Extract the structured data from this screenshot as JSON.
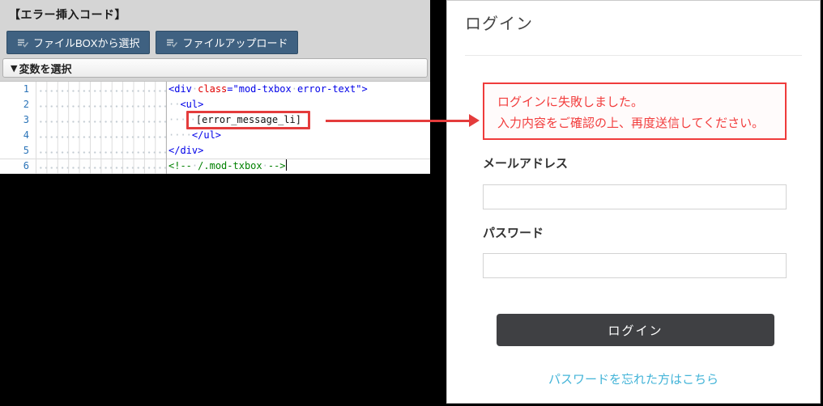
{
  "colors": {
    "annotation_red": "#e43c3c",
    "error_text_red": "#f23d3d",
    "error_border_red": "#ef3b3b",
    "toolbar_button_blue": "#3f6181",
    "login_button_dark": "#3f4043",
    "link_blue": "#43b4d8",
    "line_number_blue": "#2b74b8",
    "code_tag_blue": "#0000e8",
    "code_attr_red": "#e00000",
    "code_comment_green": "#008000"
  },
  "editor_panel": {
    "title": "【エラー挿入コード】",
    "buttons": [
      {
        "label": "ファイルBOXから選択",
        "icon": "list-check-icon"
      },
      {
        "label": "ファイルアップロード",
        "icon": "list-check-icon"
      }
    ],
    "collapse_bar": {
      "icon": "▼",
      "label": "変数を選択"
    },
    "code": {
      "lines": [
        {
          "num": "1",
          "indent": 0,
          "tokens": [
            {
              "t": "tag",
              "v": "<div"
            },
            {
              "t": "ws",
              "v": "·"
            },
            {
              "t": "attr",
              "v": "class"
            },
            {
              "t": "tag",
              "v": "="
            },
            {
              "t": "str",
              "v": "\"mod-txbox"
            },
            {
              "t": "ws",
              "v": "·"
            },
            {
              "t": "str",
              "v": "error-text\""
            },
            {
              "t": "tag",
              "v": ">"
            }
          ]
        },
        {
          "num": "2",
          "indent": 2,
          "tokens": [
            {
              "t": "tag",
              "v": "<ul>"
            }
          ]
        },
        {
          "num": "3",
          "indent": 3,
          "boxed": true,
          "tokens": [
            {
              "t": "ws",
              "v": "·"
            },
            {
              "t": "plain",
              "v": "[error_message_li]"
            }
          ]
        },
        {
          "num": "4",
          "indent": 4,
          "tokens": [
            {
              "t": "tag",
              "v": "</ul>"
            }
          ]
        },
        {
          "num": "5",
          "indent": 0,
          "tokens": [
            {
              "t": "tag",
              "v": "</div>"
            }
          ]
        },
        {
          "num": "6",
          "indent": 0,
          "current": true,
          "cursor": true,
          "tokens": [
            {
              "t": "comment",
              "v": "<!--"
            },
            {
              "t": "ws",
              "v": "·"
            },
            {
              "t": "comment",
              "v": "/.mod-txbox"
            },
            {
              "t": "ws",
              "v": "·"
            },
            {
              "t": "comment",
              "v": "-->"
            }
          ]
        }
      ]
    }
  },
  "login_preview": {
    "title": "ログイン",
    "error": {
      "line1": "ログインに失敗しました。",
      "line2": "入力内容をご確認の上、再度送信してください。"
    },
    "fields": [
      {
        "label": "メールアドレス",
        "value": ""
      },
      {
        "label": "パスワード",
        "value": ""
      }
    ],
    "submit_label": "ログイン",
    "forgot_link": "パスワードを忘れた方はこちら"
  }
}
